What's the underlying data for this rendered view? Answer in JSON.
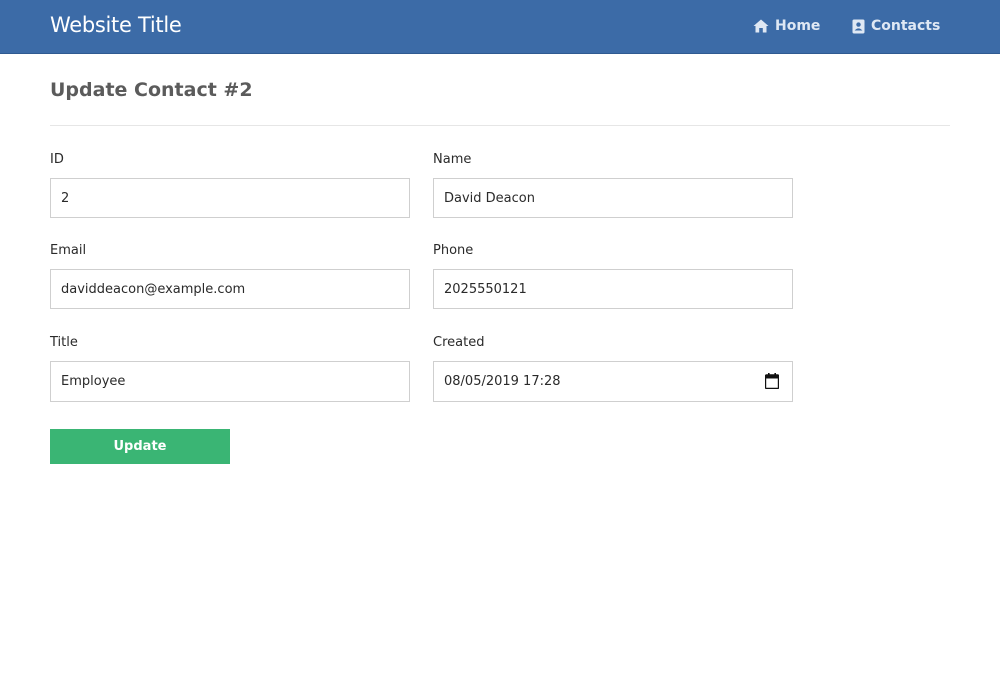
{
  "header": {
    "site_title": "Website Title",
    "nav": [
      {
        "label": "Home",
        "icon": "home-icon"
      },
      {
        "label": "Contacts",
        "icon": "address-book-icon"
      }
    ]
  },
  "page": {
    "title": "Update Contact #2"
  },
  "form": {
    "id": {
      "label": "ID",
      "value": "2"
    },
    "name": {
      "label": "Name",
      "value": "David Deacon"
    },
    "email": {
      "label": "Email",
      "value": "daviddeacon@example.com"
    },
    "phone": {
      "label": "Phone",
      "value": "2025550121"
    },
    "title": {
      "label": "Title",
      "value": "Employee"
    },
    "created": {
      "label": "Created",
      "value": "08/05/2019 17:28"
    },
    "submit_label": "Update"
  },
  "colors": {
    "navbar": "#3c6ba7",
    "button": "#3ab574"
  }
}
